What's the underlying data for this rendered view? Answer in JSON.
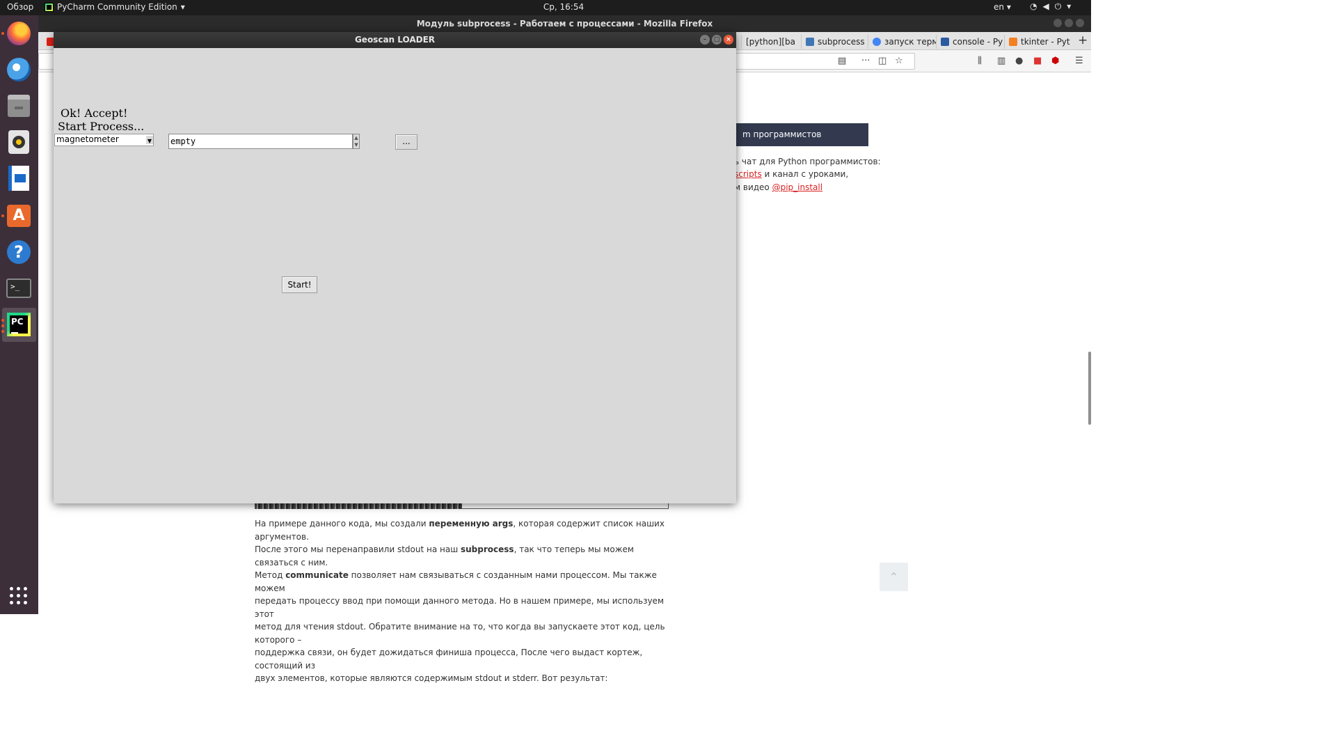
{
  "topbar": {
    "overview": "Обзор",
    "app_name": "PyCharm Community Edition",
    "clock": "Ср, 16:54",
    "lang": "en"
  },
  "firefox": {
    "window_title": "Модуль subprocess - Работаем с процессами - Mozilla Firefox",
    "tabs": [
      {
        "label": "[python][ba",
        "icon_color": "#8fb8e8"
      },
      {
        "label": "subprocess",
        "icon_color": "#3f77b5"
      },
      {
        "label": "запуск терм",
        "icon_color": "#4285f4"
      },
      {
        "label": "console - Py",
        "icon_color": "#2c5aa0"
      },
      {
        "label": "tkinter - Pyt",
        "icon_color": "#f48024"
      }
    ],
    "sidebar": {
      "banner": "m программистов",
      "line1": "ь чат для Python программистов:",
      "line2_link": "scripts",
      "line2_rest": " и канал с уроками,",
      "line3_pre": "м видео ",
      "line3_link": "@pip_install"
    },
    "article": {
      "p1_a": "На примере данного кода, мы создали ",
      "p1_b": "переменную args",
      "p1_c": ", которая содержит список наших аргументов.",
      "p2_a": "После этого мы перенаправили stdout на наш ",
      "p2_b": "subprocess",
      "p2_c": ", так что теперь мы можем связаться с ним.",
      "p3_a": "Метод ",
      "p3_b": "communicate",
      "p3_c": " позволяет нам связываться с созданным нами процессом. Мы также можем",
      "p4": "передать процессу ввод при помощи данного метода. Но в нашем примере, мы используем этот",
      "p5": "метод для чтения stdout. Обратите внимание на то, что когда вы запускаете этот код, цель которого –",
      "p6": "поддержка связи, он будет дожидаться финиша процесса, После чего выдаст кортеж, состоящий из",
      "p7": "двух элементов, которые являются содержимым stdout и stderr. Вот результат:"
    }
  },
  "dock": {
    "items": [
      "firefox-icon",
      "thunderbird-icon",
      "files-icon",
      "rhythmbox-icon",
      "writer-icon",
      "software-icon",
      "help-icon",
      "terminal-icon",
      "pycharm-icon"
    ]
  },
  "tk": {
    "title": "Geoscan LOADER",
    "label_accept": "Ok! Accept!",
    "label_start": "Start Process...",
    "combo_value": "magnetometer",
    "entry_value": "empty",
    "browse_label": "...",
    "start_label": "Start!"
  }
}
